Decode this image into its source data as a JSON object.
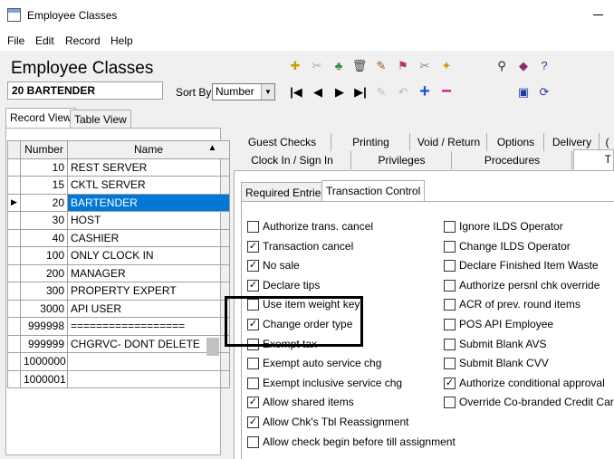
{
  "window": {
    "title": "Employee Classes"
  },
  "menu": [
    "File",
    "Edit",
    "Record",
    "Help"
  ],
  "header": {
    "title": "Employee Classes",
    "record": "20 BARTENDER",
    "sort_by_label": "Sort By",
    "sort_by_value": "Number"
  },
  "view_tabs": [
    "Record View",
    "Table View"
  ],
  "grid": {
    "columns": [
      "Number",
      "Name"
    ],
    "rows": [
      {
        "number": "10",
        "name": "REST SERVER"
      },
      {
        "number": "15",
        "name": "CKTL SERVER"
      },
      {
        "number": "20",
        "name": "BARTENDER"
      },
      {
        "number": "30",
        "name": "HOST"
      },
      {
        "number": "40",
        "name": "CASHIER"
      },
      {
        "number": "100",
        "name": "ONLY CLOCK IN"
      },
      {
        "number": "200",
        "name": "MANAGER"
      },
      {
        "number": "300",
        "name": "PROPERTY EXPERT"
      },
      {
        "number": "3000",
        "name": "API USER"
      },
      {
        "number": "999998",
        "name": "=================="
      },
      {
        "number": "999999",
        "name": "CHGRVC- DONT DELETE"
      },
      {
        "number": "1000000",
        "name": ""
      },
      {
        "number": "1000001",
        "name": ""
      }
    ],
    "selected_index": 2
  },
  "right_tabs_row1": [
    "Guest Checks",
    "Printing",
    "Void / Return",
    "Options",
    "Delivery",
    "("
  ],
  "right_tabs_row2": [
    "Clock In / Sign In",
    "Privileges",
    "Procedures",
    "T"
  ],
  "sub_tabs": [
    "Required Entries",
    "Transaction Control"
  ],
  "options_left": [
    {
      "label": "Authorize trans. cancel",
      "checked": false
    },
    {
      "label": "Transaction cancel",
      "checked": true
    },
    {
      "label": "No sale",
      "checked": true
    },
    {
      "label": "Declare tips",
      "checked": true
    },
    {
      "label": "Use item weight key",
      "checked": false
    },
    {
      "label": "Change order type",
      "checked": true
    },
    {
      "label": "Exempt tax",
      "checked": false
    },
    {
      "label": "Exempt auto service chg",
      "checked": false
    },
    {
      "label": "Exempt inclusive service chg",
      "checked": false
    },
    {
      "label": "Allow shared items",
      "checked": true
    },
    {
      "label": "Allow Chk's Tbl Reassignment",
      "checked": true
    },
    {
      "label": "Allow check begin before till assignment",
      "checked": false
    }
  ],
  "options_right": [
    {
      "label": "Ignore ILDS Operator",
      "checked": false
    },
    {
      "label": "Change ILDS Operator",
      "checked": false
    },
    {
      "label": "Declare Finished Item Waste",
      "checked": false
    },
    {
      "label": "Authorize persnl chk override",
      "checked": false
    },
    {
      "label": "ACR of prev. round items",
      "checked": false
    },
    {
      "label": "POS API Employee",
      "checked": false
    },
    {
      "label": "Submit Blank AVS",
      "checked": false
    },
    {
      "label": "Submit Blank CVV",
      "checked": false
    },
    {
      "label": "Authorize conditional approval",
      "checked": true
    },
    {
      "label": "Override Co-branded Credit Card",
      "checked": false
    }
  ],
  "colors": {
    "selection": "#0078d7",
    "toolbar_blue": "#1a55c8",
    "toolbar_magenta": "#c0188a"
  }
}
